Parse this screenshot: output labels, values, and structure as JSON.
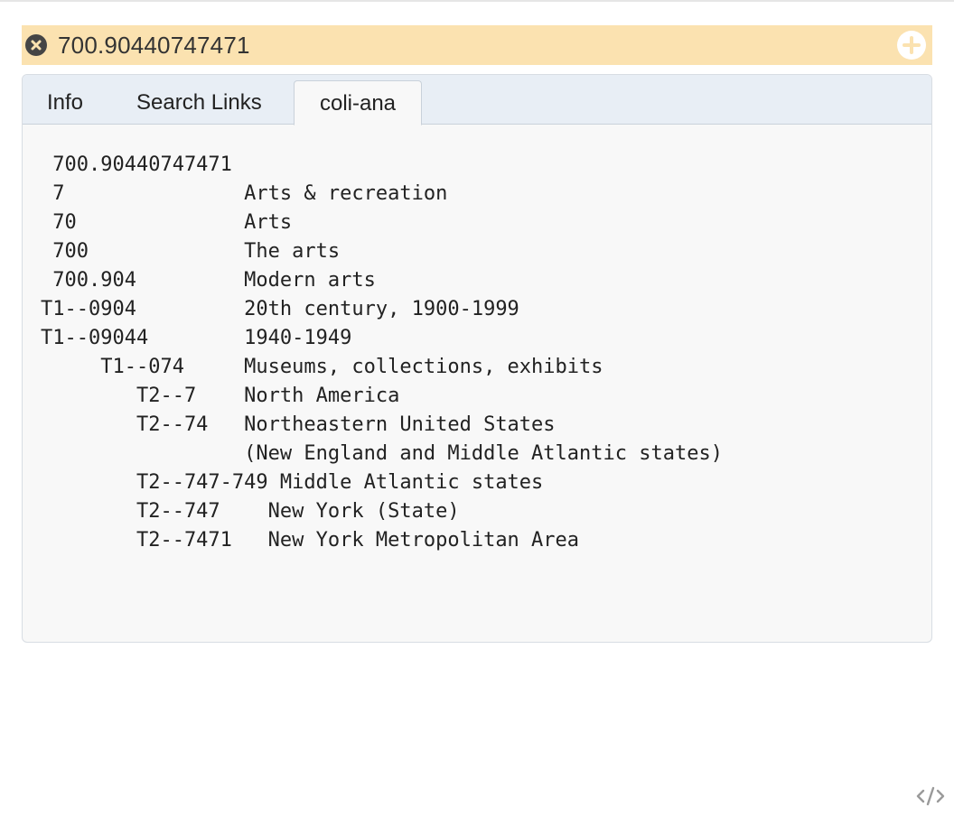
{
  "header": {
    "title": "700.90440747471",
    "close_icon": "close-circle-icon",
    "add_icon": "plus-circle-icon",
    "accent_color": "#fbe2b0"
  },
  "tabs": [
    {
      "label": "Info",
      "active": false
    },
    {
      "label": "Search Links",
      "active": false
    },
    {
      "label": "coli-ana",
      "active": true
    }
  ],
  "analysis": {
    "lines": [
      {
        "text": " 700.90440747471"
      },
      {
        "text": " 7               Arts & recreation"
      },
      {
        "text": " 70              Arts"
      },
      {
        "text": " 700             The arts"
      },
      {
        "text": " 700.904         Modern arts"
      },
      {
        "text": "T1--0904         20th century, 1900-1999"
      },
      {
        "text": "T1--09044        1940-1949"
      },
      {
        "text": "     T1--074     Museums, collections, exhibits"
      },
      {
        "text": "        T2--7    North America"
      },
      {
        "text": "        T2--74   Northeastern United States"
      },
      {
        "text": "                 (New England and Middle Atlantic states)"
      },
      {
        "text": "        T2--747-749 Middle Atlantic states"
      },
      {
        "text": "        T2--747    New York (State)"
      },
      {
        "text": "        T2--7471   New York Metropolitan Area"
      }
    ]
  },
  "footer": {
    "embed_icon": "code-embed-icon"
  }
}
